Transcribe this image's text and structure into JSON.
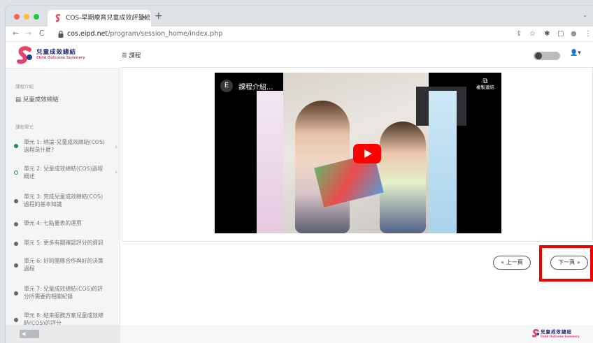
{
  "colors": {
    "accent_red": "#f10000",
    "brand_navy": "#1c2b6b",
    "brand_pink": "#e5456c",
    "youtube_red": "#ff0000"
  },
  "browser": {
    "tab_title": "COS-早期療育兒童成效評量統...",
    "tab_close": "×",
    "new_tab": "+",
    "url_host": "cos.eipd.net",
    "url_path": "/program/session_home/index.php",
    "back": "←",
    "forward": "→",
    "reload": "C",
    "share_icon": "⇪",
    "star_icon": "☆",
    "ext_icon": "✱",
    "sidebar_icon": "▢",
    "profile_icon": "●",
    "menu_icon": "⋮"
  },
  "app": {
    "logo_cn": "兒童成效總結",
    "logo_en": "Child Outcome Summary",
    "menu_label": "☰ 課程",
    "user_icon": "👤▾"
  },
  "sidebar": {
    "section1": "課程介紹",
    "course": "兒童成效總結",
    "section2": "課程單元",
    "units": [
      {
        "label": "單元 1: 總論-兒童成效總結(COS)過程是什麼?",
        "status": "done"
      },
      {
        "label": "單元 2: 兒童成效總結(COS)過程概述",
        "status": "current"
      },
      {
        "label": "單元 3: 完成兒童成效總結(COS)過程的基本知識",
        "status": "todo"
      },
      {
        "label": "單元 4: 七點量表的運用",
        "status": "todo"
      },
      {
        "label": "單元 5: 更多有關確認評分的資訊",
        "status": "todo"
      },
      {
        "label": "單元 6: 好的團隊合作與好的決策過程",
        "status": "todo"
      },
      {
        "label": "單元 7: 兒童成效總結(COS)的評分所需要的相關紀錄",
        "status": "todo"
      },
      {
        "label": "單元 8: 結束服務方案兒童成效總結(COS)的評分",
        "status": "todo"
      }
    ],
    "footer_btn": "◀"
  },
  "video": {
    "avatar": "E",
    "title": "課程介紹...",
    "copy_icon": "⧉",
    "copy_label": "複製連結"
  },
  "pager": {
    "prev": "« 上一頁",
    "next": "下一頁 »"
  },
  "footer": {
    "logo_cn": "兒童成效總結",
    "logo_en": "Child Outcome Summary"
  }
}
